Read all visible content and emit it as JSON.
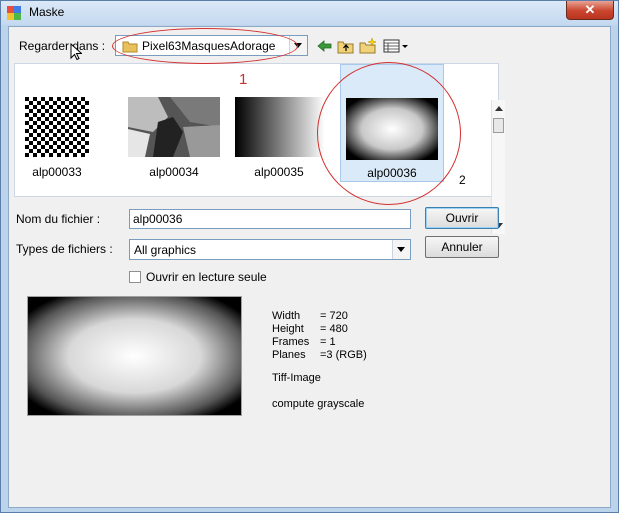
{
  "window": {
    "title": "Maske",
    "close_glyph": "✕"
  },
  "look_in": {
    "label": "Regarder dans :",
    "folder": "Pixel63MasquesAdorage"
  },
  "toolbar": {
    "back_icon": "back-arrow-icon",
    "up_icon": "folder-up-icon",
    "new_folder_icon": "new-folder-icon",
    "view_icon": "view-menu-icon"
  },
  "files": [
    {
      "name": "alp00033",
      "thumb": "checkerboard"
    },
    {
      "name": "alp00034",
      "thumb": "gray-shapes"
    },
    {
      "name": "alp00035",
      "thumb": "horizontal-gradient"
    },
    {
      "name": "alp00036",
      "thumb": "vignette-gradient",
      "selected": true
    }
  ],
  "filename": {
    "label": "Nom du fichier :",
    "value": "alp00036"
  },
  "filetype": {
    "label": "Types de fichiers :",
    "value": "All graphics"
  },
  "buttons": {
    "open": "Ouvrir",
    "cancel": "Annuler"
  },
  "readonly": {
    "label": "Ouvrir en lecture seule",
    "checked": false
  },
  "info": {
    "width_label": "Width",
    "width_value": "= 720",
    "height_label": "Height",
    "height_value": "= 480",
    "frames_label": "Frames",
    "frames_value": "= 1",
    "planes_label": "Planes",
    "planes_value": "=3 (RGB)",
    "format": "Tiff-Image",
    "compute": "compute grayscale"
  },
  "annotations": {
    "num1": "1",
    "num2": "2",
    "color": "#d43030"
  }
}
